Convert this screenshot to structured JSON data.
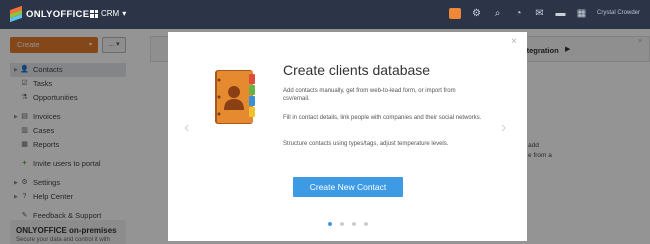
{
  "topbar": {
    "logo": "ONLYOFFICE",
    "module": "CRM",
    "module_caret": "▾",
    "user": "Crystal Crowder",
    "icons": [
      "gift-icon",
      "gear-icon",
      "search-icon",
      "feed-icon",
      "mail-icon",
      "chat-icon",
      "calendar-icon"
    ]
  },
  "toolbar": {
    "create_label": "Create",
    "create_caret": "▾",
    "more_label": "... ▾"
  },
  "sidebar": {
    "items": [
      {
        "label": "Contacts",
        "icon": "contacts-icon",
        "glyph": "👤",
        "active": true,
        "arrow": true
      },
      {
        "label": "Tasks",
        "icon": "tasks-icon",
        "glyph": "☑",
        "sub": true
      },
      {
        "label": "Opportunities",
        "icon": "opportunities-icon",
        "glyph": "⚗",
        "sub": true
      },
      {
        "label": "Invoices",
        "icon": "invoices-icon",
        "glyph": "▤",
        "arrow": true
      },
      {
        "label": "Cases",
        "icon": "cases-icon",
        "glyph": "▥",
        "sub": true
      },
      {
        "label": "Reports",
        "icon": "reports-icon",
        "glyph": "▦",
        "sub": true
      },
      {
        "label": "Invite users to portal",
        "icon": "plus-icon",
        "glyph": "+",
        "sub": true
      },
      {
        "label": "Settings",
        "icon": "settings-icon",
        "glyph": "⚙",
        "arrow": true
      },
      {
        "label": "Help Center",
        "icon": "help-icon",
        "glyph": "?",
        "arrow": true
      },
      {
        "label": "Feedback & Support",
        "icon": "feedback-icon",
        "glyph": "✎",
        "sub": true
      }
    ]
  },
  "promo": {
    "title": "ONLYOFFICE on-premises",
    "subtitle": "Secure your data and control it with"
  },
  "background": {
    "integration_label": "ntegration",
    "arrow": "▶",
    "close": "×",
    "lines": [
      "e",
      "add",
      "e from a",
      ""
    ]
  },
  "modal": {
    "title": "Create clients database",
    "paragraphs": [
      "Add contacts manually, get from web-to-lead form, or import from csv/email.",
      "Fill in contact details, link people with companies and their social networks.",
      "Structure contacts using types/tags, adjust temperature levels."
    ],
    "button_label": "Create New Contact",
    "close": "×",
    "prev": "‹",
    "next": "›",
    "page_count": 4,
    "current_page": 1
  },
  "colors": {
    "topbar": "#2b3547",
    "accent_orange": "#e27b2c",
    "accent_blue": "#3d9be6"
  }
}
